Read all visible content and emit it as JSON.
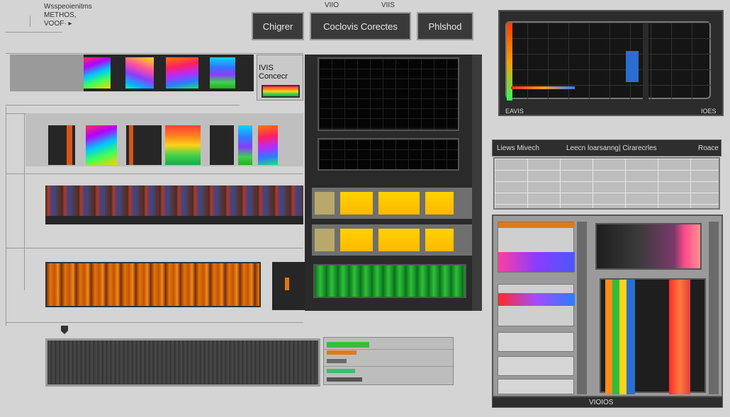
{
  "header": {
    "line1": "Wsspeoienitms",
    "line2": "METHOS,",
    "line3": "VOOF· ▸",
    "top_mid": "VIIO",
    "top_right": "VIIS"
  },
  "toolbar": {
    "chart_label": "Chigrer",
    "center_label": "Coclovis Corectes",
    "plot_label": "Phlshod"
  },
  "middle_panel": {
    "title": "IVIS Concecr"
  },
  "top_right_panel": {
    "footer_left": "EAVIS",
    "footer_right": "IOES"
  },
  "right_panel": {
    "header_left": "Liews Mivech",
    "header_mid": "Leecn loarsanng| Cirarecrles",
    "header_right": "Roace",
    "footer": "VIOIOS"
  },
  "colors": {
    "background": "#d4d4d4",
    "dark_panel": "#262626",
    "accent_yellow": "#ffc400",
    "accent_orange": "#e0750f",
    "accent_green": "#2fbf3a"
  }
}
